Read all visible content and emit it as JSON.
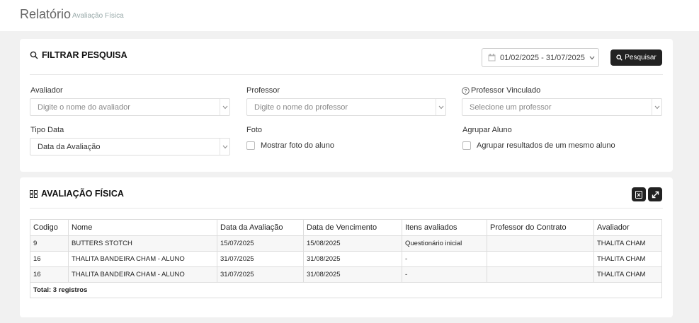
{
  "page": {
    "title": "Relatório",
    "subtitle": "Avaliação Física"
  },
  "filter": {
    "title": "FILTRAR PESQUISA",
    "date_range": "01/02/2025 - 31/07/2025",
    "search_button": "Pesquisar",
    "avaliador": {
      "label": "Avaliador",
      "placeholder": "Digite o nome do avaliador"
    },
    "professor": {
      "label": "Professor",
      "placeholder": "Digite o nome do professor"
    },
    "professor_vinculado": {
      "label": "Professor Vinculado",
      "placeholder": "Selecione um professor"
    },
    "tipo_data": {
      "label": "Tipo Data",
      "value": "Data da Avaliação"
    },
    "foto": {
      "label": "Foto",
      "checkbox_label": "Mostrar foto do aluno"
    },
    "agrupar": {
      "label": "Agrupar Aluno",
      "checkbox_label": "Agrupar resultados de um mesmo aluno"
    }
  },
  "results": {
    "title": "AVALIAÇÃO FÍSICA",
    "columns": [
      "Codigo",
      "Nome",
      "Data da Avaliação",
      "Data de Vencimento",
      "Itens avaliados",
      "Professor do Contrato",
      "Avaliador"
    ],
    "rows": [
      [
        "9",
        "BUTTERS STOTCH",
        "15/07/2025",
        "15/08/2025",
        "Questionário inicial",
        "",
        "THALITA CHAM"
      ],
      [
        "16",
        "THALITA BANDEIRA CHAM - ALUNO",
        "31/07/2025",
        "31/08/2025",
        "-",
        "",
        "THALITA CHAM"
      ],
      [
        "16",
        "THALITA BANDEIRA CHAM - ALUNO",
        "31/07/2025",
        "31/08/2025",
        "-",
        "",
        "THALITA CHAM"
      ]
    ],
    "total": "Total: 3 registros"
  }
}
